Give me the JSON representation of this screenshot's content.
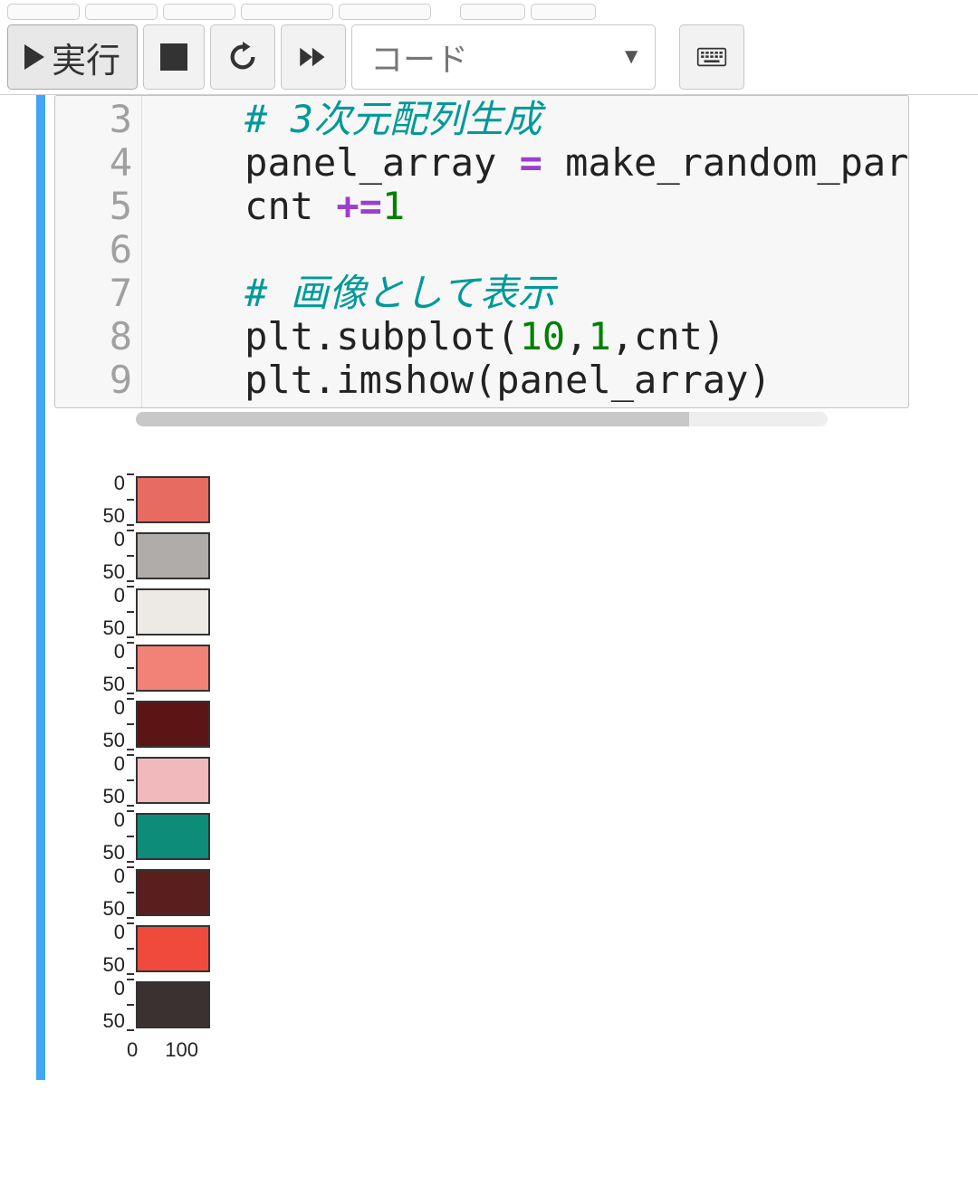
{
  "toolbar": {
    "run_label": "実行",
    "cell_type": "コード"
  },
  "code": {
    "gutter": [
      "3",
      "4",
      "5",
      "6",
      "7",
      "8",
      "9"
    ],
    "lines": [
      {
        "indent": "    ",
        "segments": [
          {
            "cls": "cm",
            "text": "# 3次元配列生成"
          }
        ]
      },
      {
        "indent": "    ",
        "segments": [
          {
            "cls": "",
            "text": "panel_array "
          },
          {
            "cls": "op",
            "text": "="
          },
          {
            "cls": "",
            "text": " make_random_par"
          }
        ]
      },
      {
        "indent": "    ",
        "segments": [
          {
            "cls": "",
            "text": "cnt "
          },
          {
            "cls": "op",
            "text": "+="
          },
          {
            "cls": "num",
            "text": "1"
          }
        ]
      },
      {
        "indent": "    ",
        "segments": [
          {
            "cls": "",
            "text": ""
          }
        ]
      },
      {
        "indent": "    ",
        "segments": [
          {
            "cls": "cm",
            "text": "# 画像として表示"
          }
        ]
      },
      {
        "indent": "    ",
        "segments": [
          {
            "cls": "",
            "text": "plt.subplot("
          },
          {
            "cls": "num",
            "text": "10"
          },
          {
            "cls": "",
            "text": ","
          },
          {
            "cls": "num",
            "text": "1"
          },
          {
            "cls": "",
            "text": ",cnt)"
          }
        ]
      },
      {
        "indent": "    ",
        "segments": [
          {
            "cls": "",
            "text": "plt.imshow(panel_array)"
          }
        ]
      }
    ]
  },
  "chart_data": {
    "type": "imshow-grid",
    "description": "10 stacked single-color imshow panels",
    "y_ticks": [
      "0",
      "50"
    ],
    "x_ticks": [
      "0",
      "100"
    ],
    "xlim": [
      0,
      100
    ],
    "ylim_each": [
      0,
      50
    ],
    "panels": [
      {
        "color": "#E86B61"
      },
      {
        "color": "#B0ACA9"
      },
      {
        "color": "#EDEAE6"
      },
      {
        "color": "#F28178"
      },
      {
        "color": "#5C1414"
      },
      {
        "color": "#F1B9BC"
      },
      {
        "color": "#0E8C7A"
      },
      {
        "color": "#5B1E1E"
      },
      {
        "color": "#EF4A3C"
      },
      {
        "color": "#3B3130"
      }
    ]
  }
}
